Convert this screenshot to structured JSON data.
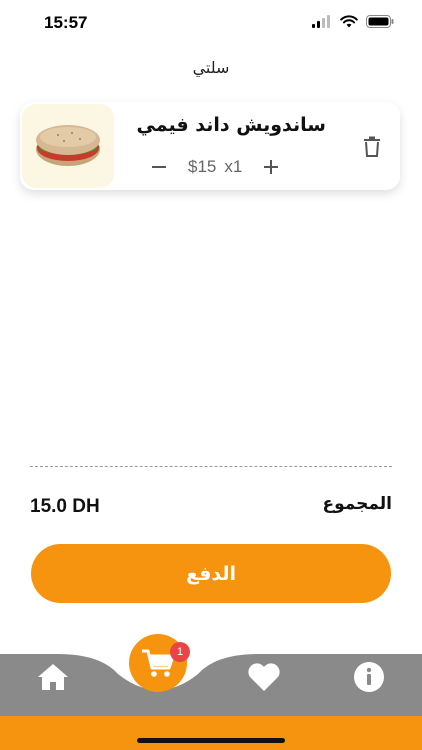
{
  "status_bar": {
    "time": "15:57"
  },
  "header": {
    "title": "سلتي"
  },
  "cart": {
    "items": [
      {
        "name": "ساندويش داند فيمي",
        "price": "$15",
        "quantity": "x1",
        "minus_icon": "minus-icon",
        "plus_icon": "plus-icon",
        "delete_icon": "trash-icon"
      }
    ]
  },
  "summary": {
    "total_label": "المجموع",
    "total_value": "15.0 DH"
  },
  "checkout": {
    "pay_label": "الدفع"
  },
  "bottom_nav": {
    "cart_badge": "1",
    "items": [
      "home-icon",
      "cart-icon",
      "heart-icon",
      "info-icon"
    ]
  },
  "colors": {
    "accent": "#f7940f",
    "nav_background": "#8a8a8a",
    "nav_strip": "#f7940f",
    "badge": "#e94545",
    "thumb_background": "#fbf7e2"
  }
}
